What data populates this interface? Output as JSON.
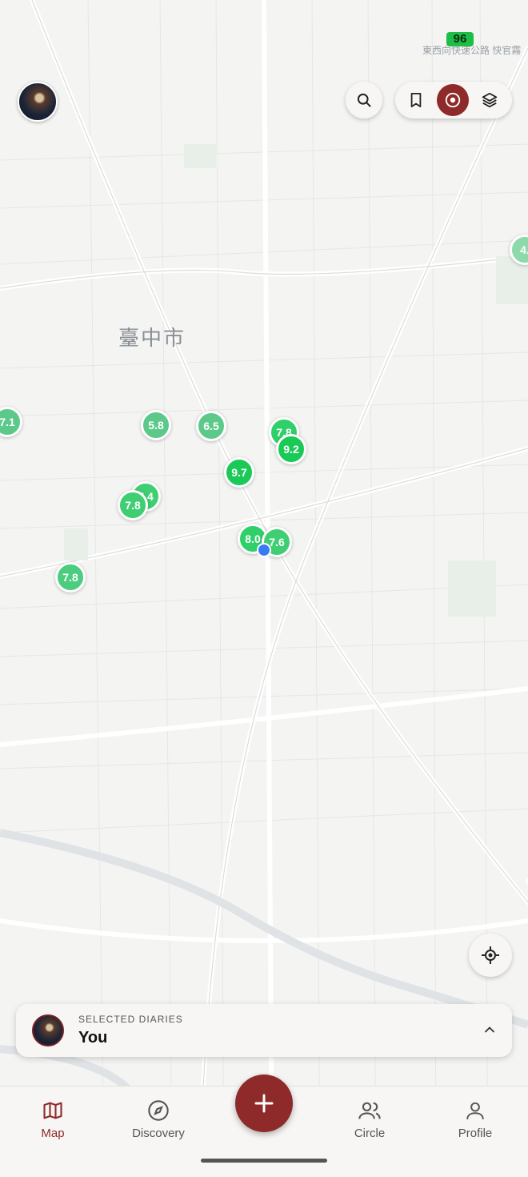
{
  "status_bar": {
    "battery": "96"
  },
  "map": {
    "city_label": "臺中市",
    "road_label": "東西向快速公路 快官霧",
    "markers": [
      {
        "value": "7.1",
        "color": "#5cc98a"
      },
      {
        "value": "5.8",
        "color": "#5cc98a"
      },
      {
        "value": "6.5",
        "color": "#5cc98a"
      },
      {
        "value": "7.8",
        "color": "#2fd06a"
      },
      {
        "value": "9.2",
        "color": "#1bc957"
      },
      {
        "value": "9.7",
        "color": "#1bc957"
      },
      {
        "value": "7.4",
        "color": "#3fcf72"
      },
      {
        "value": "7.8",
        "color": "#3fcf72"
      },
      {
        "value": "8.0",
        "color": "#2fd06a"
      },
      {
        "value": "7.6",
        "color": "#3fcf72"
      },
      {
        "value": "7.8",
        "color": "#4ccc7e"
      },
      {
        "value": "4.",
        "color": "#8cd9aa"
      }
    ]
  },
  "toolbar": {
    "search_icon": "search-icon",
    "bookmark_icon": "bookmark-icon",
    "location_icon": "target-icon",
    "layers_icon": "layers-icon"
  },
  "selected": {
    "caption": "SELECTED DIARIES",
    "name": "You"
  },
  "nav": {
    "map": "Map",
    "discovery": "Discovery",
    "circle": "Circle",
    "profile": "Profile"
  },
  "colors": {
    "accent": "#8e2a2a",
    "user_dot": "#3b7bf2"
  }
}
